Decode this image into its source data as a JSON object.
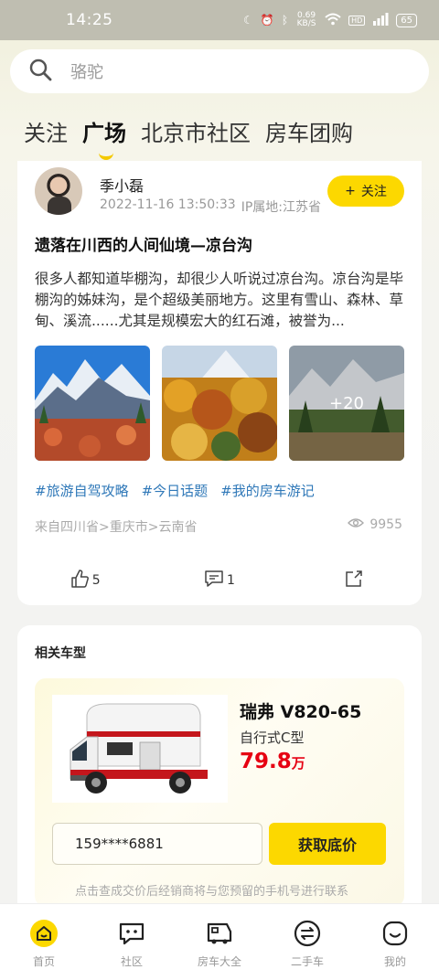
{
  "status_bar": {
    "time": "14:25",
    "net_speed": "0.69 KB/S",
    "battery": "65"
  },
  "search": {
    "placeholder": "骆驼"
  },
  "tabs": [
    {
      "label": "关注",
      "active": false
    },
    {
      "label": "广场",
      "active": true
    },
    {
      "label": "北京市社区",
      "active": false
    },
    {
      "label": "房车团购",
      "active": false
    }
  ],
  "post": {
    "author": "季小磊",
    "datetime": "2022-11-16 13:50:33",
    "ip_location": "IP属地:江苏省",
    "follow_label": "关注",
    "title": "遗落在川西的人间仙境—凉台沟",
    "body": "很多人都知道毕棚沟，却很少人听说过凉台沟。凉台沟是毕棚沟的姊妹沟，是个超级美丽地方。这里有雪山、森林、草甸、溪流......尤其是规模宏大的红石滩，被誉为...",
    "more_images": "+20",
    "tags": [
      "#旅游自驾攻略",
      "#今日话题",
      "#我的房车游记"
    ],
    "route": "来自四川省>重庆市>云南省",
    "views": "9955",
    "likes": "5",
    "comments": "1"
  },
  "related": {
    "title": "相关车型",
    "product": {
      "name": "瑞弗 V820-65",
      "type": "自行式C型",
      "price": "79.8",
      "price_unit": "万",
      "phone_value": "159****6881",
      "button_label": "获取底价",
      "note": "点击查成交价后经销商将与您预留的手机号进行联系"
    }
  },
  "bottom_nav": [
    {
      "label": "首页",
      "icon": "home-icon",
      "active": true
    },
    {
      "label": "社区",
      "icon": "community-icon"
    },
    {
      "label": "房车大全",
      "icon": "rv-catalog-icon"
    },
    {
      "label": "二手车",
      "icon": "used-car-icon"
    },
    {
      "label": "我的",
      "icon": "profile-icon"
    }
  ],
  "colors": {
    "accent": "#fcd800",
    "price": "#e60012",
    "tag": "#2f78b8"
  }
}
